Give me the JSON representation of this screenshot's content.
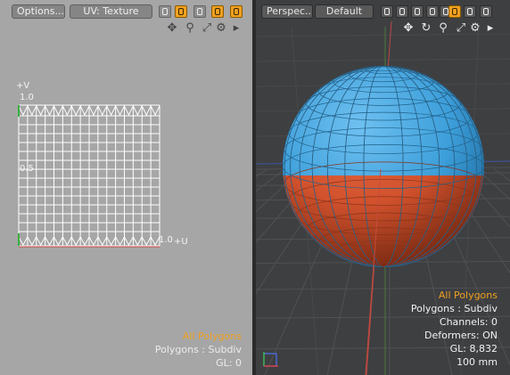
{
  "uv_view": {
    "options_label": "Options....",
    "uv_map_label": "UV: Texture",
    "axis_v": "+V",
    "axis_u": "+U",
    "tick_top": "1.0",
    "tick_mid": "0.5",
    "tick_right": "1.0",
    "hud": {
      "selection": "All Polygons",
      "polygons": "Polygons : Subdiv",
      "gl": "GL: 0"
    }
  },
  "viewport": {
    "view_label": "Perspec...",
    "shading_label": "Default",
    "hud": {
      "selection": "All Polygons",
      "polygons": "Polygons : Subdiv",
      "channels": "Channels: 0",
      "deformers": "Deformers: ON",
      "gl": "GL: 8,832",
      "scale": "100 mm"
    }
  },
  "icons": {
    "uv_toolbar": [
      "uv-display-icon",
      "uv-wire-icon",
      "uv-texture-icon",
      "uv-overlay-icon",
      "uv-lock-icon"
    ],
    "viewport_toolbar": [
      "vertex-icon",
      "edge-icon",
      "polygon-icon",
      "item-icon",
      "material-icon",
      "action-center-icon",
      "falloff-icon",
      "symmetry-icon"
    ],
    "nav": [
      "move-view-icon",
      "rotate-view-icon",
      "zoom-view-icon",
      "fit-view-icon",
      "gear-icon",
      "play-arrow-icon"
    ]
  },
  "colors": {
    "accent": "#f0a020",
    "sphere_top": "#3d9fda",
    "sphere_bottom": "#d2522d",
    "uv_background": "#a6a6a6",
    "viewport_background": "#3e3f41"
  }
}
